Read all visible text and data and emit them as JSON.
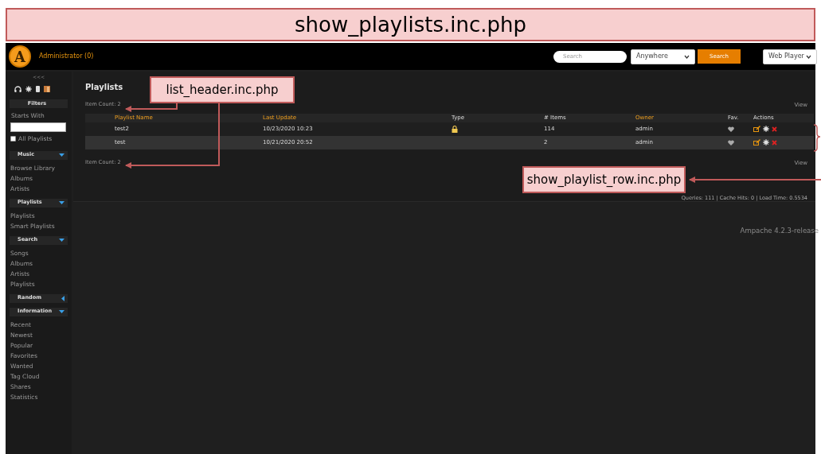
{
  "banner": {
    "title": "show_playlists.inc.php"
  },
  "header": {
    "logo": "A",
    "user": "Administrator (0)",
    "search": {
      "placeholder": "Search"
    },
    "scope": "Anywhere",
    "search_button": "Search",
    "player": "Web Player"
  },
  "sidebar": {
    "collapse": "<<<",
    "filters": {
      "title": "Filters",
      "starts_with": "Starts With",
      "all_playlists": {
        "label": "All Playlists",
        "checked": false
      }
    },
    "sections": [
      {
        "title": "Music",
        "expanded": true,
        "items": [
          "Browse Library",
          "Albums",
          "Artists"
        ]
      },
      {
        "title": "Playlists",
        "expanded": true,
        "items": [
          "Playlists",
          "Smart Playlists"
        ]
      },
      {
        "title": "Search",
        "expanded": true,
        "items": [
          "Songs",
          "Albums",
          "Artists",
          "Playlists"
        ]
      },
      {
        "title": "Random",
        "expanded": false
      },
      {
        "title": "Information",
        "expanded": true,
        "items": [
          "Recent",
          "Newest",
          "Popular",
          "Favorites",
          "Wanted",
          "Tag Cloud",
          "Shares",
          "Statistics"
        ]
      }
    ]
  },
  "main": {
    "title": "Playlists",
    "item_count_top": "Item Count: 2",
    "view_top": "View",
    "item_count_bottom": "Item Count: 2",
    "view_bottom": "View",
    "table": {
      "columns": [
        {
          "label": "Playlist Name",
          "sortable": true
        },
        {
          "label": "Last Update",
          "sortable": true
        },
        {
          "label": "Type",
          "sortable": false
        },
        {
          "label": "# Items",
          "sortable": false
        },
        {
          "label": "Owner",
          "sortable": true
        },
        {
          "label": "Fav.",
          "sortable": false
        },
        {
          "label": "Actions",
          "sortable": false
        }
      ],
      "rows": [
        {
          "name": "test2",
          "last_update": "10/23/2020 10:23",
          "locked": true,
          "items": "114",
          "owner": "admin"
        },
        {
          "name": "test",
          "last_update": "10/21/2020 20:52",
          "locked": false,
          "items": "2",
          "owner": "admin"
        }
      ]
    },
    "stats": "Queries: 111 | Cache Hits: 0 | Load Time: 0.5534"
  },
  "footer": {
    "version": "Ampache 4.2.3-release"
  },
  "annotations": [
    {
      "label": "list_header.inc.php"
    },
    {
      "label": "show_playlist_row.inc.php"
    }
  ]
}
